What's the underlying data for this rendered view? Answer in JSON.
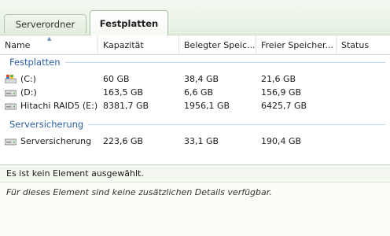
{
  "tabs": [
    {
      "label": "Serverordner",
      "active": false
    },
    {
      "label": "Festplatten",
      "active": true
    }
  ],
  "columns": {
    "name": "Name",
    "capacity": "Kapazität",
    "used": "Belegter Speic...",
    "free": "Freier Speicher...",
    "status": "Status"
  },
  "groups": [
    {
      "title": "Festplatten",
      "rows": [
        {
          "icon": "windows-drive-icon",
          "name": "(C:)",
          "capacity": "60 GB",
          "used": "38,4 GB",
          "free": "21,6 GB",
          "status": ""
        },
        {
          "icon": "hard-drive-icon",
          "name": "(D:)",
          "capacity": "163,5 GB",
          "used": "6,6 GB",
          "free": "156,9 GB",
          "status": ""
        },
        {
          "icon": "hard-drive-icon",
          "name": "Hitachi RAID5 (E:)",
          "capacity": "8381,7 GB",
          "used": "1956,1 GB",
          "free": "6425,7 GB",
          "status": ""
        }
      ]
    },
    {
      "title": "Serversicherung",
      "rows": [
        {
          "icon": "hard-drive-icon",
          "name": "Serversicherung",
          "capacity": "223,6 GB",
          "used": "33,1 GB",
          "free": "190,4 GB",
          "status": ""
        }
      ]
    }
  ],
  "details": {
    "selection_text": "Es ist kein Element ausgewählt.",
    "info_text": "Für dieses Element sind keine zusätzlichen Details verfügbar."
  },
  "colors": {
    "group_title": "#2c5fa3",
    "tab_background": "#e4efe0"
  }
}
